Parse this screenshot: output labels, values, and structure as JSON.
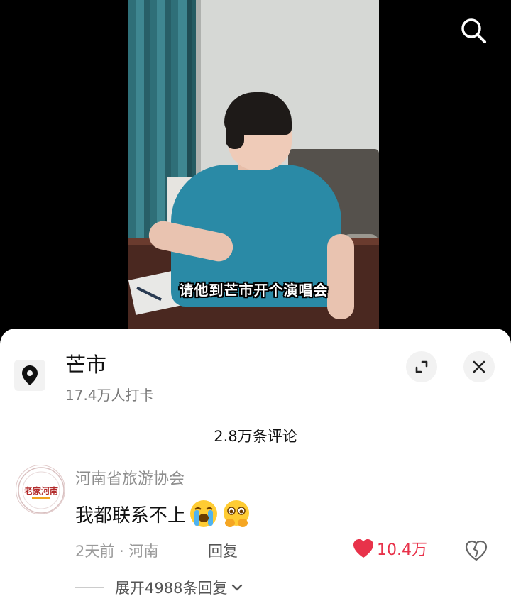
{
  "video": {
    "subtitle": "请他到芒市开个演唱会"
  },
  "icons": {
    "search": "search-icon",
    "location": "location-pin-icon",
    "expand": "expand-icon",
    "close": "close-icon",
    "like": "heart-icon",
    "dislike": "broken-heart-icon",
    "chevron": "chevron-down-icon",
    "emoji_1": "loudly-crying-face-emoji",
    "emoji_2": "face-holding-back-tears-emoji"
  },
  "location": {
    "name": "芒市",
    "checkins": "17.4万人打卡"
  },
  "comments_header": {
    "count_label": "2.8万条评论"
  },
  "comment": {
    "author": "河南省旅游协会",
    "avatar_text": "老家河南",
    "text": "我都联系不上",
    "meta": "2天前 · 河南",
    "reply_label": "回复",
    "like_count": "10.4万",
    "expand_replies_label": "展开4988条回复"
  },
  "colors": {
    "like_red": "#e8324a",
    "muted_gray": "#8e8e8e"
  }
}
